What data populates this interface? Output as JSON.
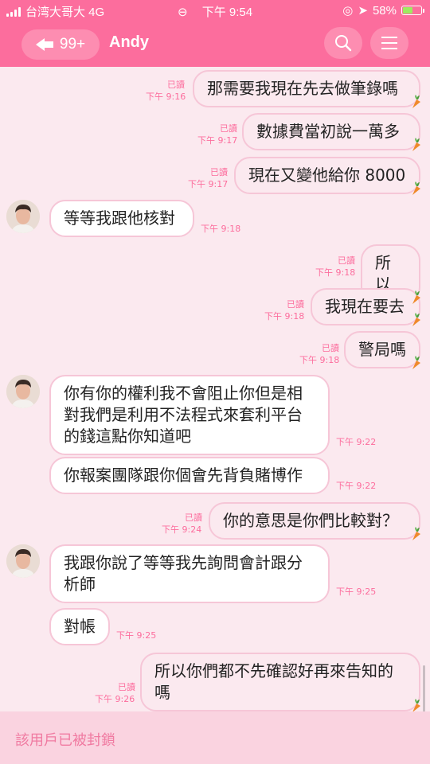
{
  "status_bar": {
    "carrier": "台湾大哥大 4G",
    "time": "下午 9:54",
    "battery": "58%",
    "battery_level": 0.58
  },
  "header": {
    "back_count": "99+",
    "title": "Andy"
  },
  "messages": [
    {
      "side": "sent",
      "text": "那需要我現在先去做筆錄嗎",
      "read": "已讀",
      "time": "下午 9:16"
    },
    {
      "side": "sent",
      "text": "數據費當初說一萬多",
      "read": "已讀",
      "time": "下午 9:17"
    },
    {
      "side": "sent",
      "text": "現在又變他給你 8000",
      "read": "已讀",
      "time": "下午 9:17"
    },
    {
      "side": "received",
      "text": "等等我跟他核對",
      "time": "下午 9:18"
    },
    {
      "side": "sent",
      "text": "所以",
      "read": "已讀",
      "time": "下午 9:18"
    },
    {
      "side": "sent",
      "text": "我現在要去",
      "read": "已讀",
      "time": "下午 9:18"
    },
    {
      "side": "sent",
      "text": "警局嗎",
      "read": "已讀",
      "time": "下午 9:18"
    },
    {
      "side": "received",
      "text": "你有你的權利我不會阻止你但是相\n對我們是利用不法程式來套利平台\n的錢這點你知道吧",
      "time": "下午 9:22"
    },
    {
      "side": "received",
      "text": "你報案團隊跟你個會先背負賭博作",
      "time": "下午 9:22"
    },
    {
      "side": "sent",
      "text": "你的意思是你們比較對？",
      "read": "已讀",
      "time": "下午 9:24"
    },
    {
      "side": "received",
      "text": "我跟你說了等等我先詢問會計跟分\n析師",
      "time": "下午 9:25"
    },
    {
      "side": "received",
      "text": "對帳",
      "time": "下午 9:25"
    },
    {
      "side": "sent",
      "text": "所以你們都不先確認好再來告知的\n嗎",
      "read": "已讀",
      "time": "下午 9:26"
    }
  ],
  "footer": {
    "blocked_text": "該用戶已被封鎖"
  },
  "colors": {
    "accent": "#fc6d9d",
    "bubble_border": "#f6c6d7",
    "background": "#fbe9ef"
  }
}
